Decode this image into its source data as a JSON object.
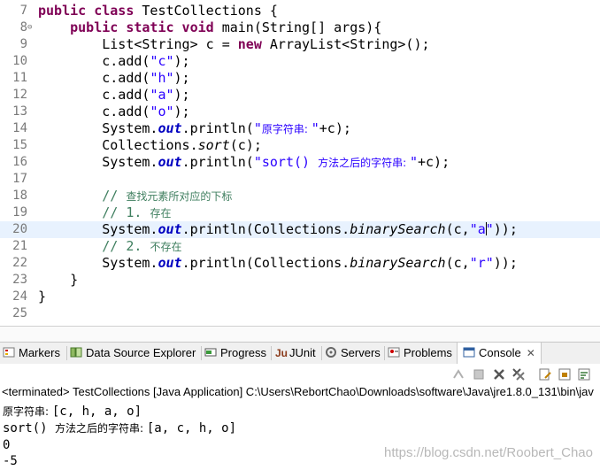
{
  "editor": {
    "lines": [
      {
        "num": "7",
        "code": [
          [
            "kw",
            "public class "
          ],
          [
            "",
            "TestCollections {"
          ]
        ]
      },
      {
        "num": "8",
        "fold": "⊖",
        "code": [
          [
            "",
            "    "
          ],
          [
            "kw",
            "public static void "
          ],
          [
            "",
            "main(String[] args){"
          ]
        ]
      },
      {
        "num": "9",
        "code": [
          [
            "",
            "        List<String> c = "
          ],
          [
            "kw",
            "new "
          ],
          [
            "",
            "ArrayList<String>();"
          ]
        ]
      },
      {
        "num": "10",
        "code": [
          [
            "",
            "        c.add("
          ],
          [
            "str",
            "\"c\""
          ],
          [
            "",
            ");"
          ]
        ]
      },
      {
        "num": "11",
        "code": [
          [
            "",
            "        c.add("
          ],
          [
            "str",
            "\"h\""
          ],
          [
            "",
            ");"
          ]
        ]
      },
      {
        "num": "12",
        "code": [
          [
            "",
            "        c.add("
          ],
          [
            "str",
            "\"a\""
          ],
          [
            "",
            ");"
          ]
        ]
      },
      {
        "num": "13",
        "code": [
          [
            "",
            "        c.add("
          ],
          [
            "str",
            "\"o\""
          ],
          [
            "",
            ");"
          ]
        ]
      },
      {
        "num": "14",
        "code": [
          [
            "",
            "        System."
          ],
          [
            "fld",
            "out"
          ],
          [
            "",
            ".println("
          ],
          [
            "str",
            "\""
          ],
          [
            "str cjk",
            "原字符串: "
          ],
          [
            "str",
            "\""
          ],
          [
            "",
            "+c);"
          ]
        ]
      },
      {
        "num": "15",
        "code": [
          [
            "",
            "        Collections."
          ],
          [
            "mth",
            "sort"
          ],
          [
            "",
            "(c);"
          ]
        ]
      },
      {
        "num": "16",
        "code": [
          [
            "",
            "        System."
          ],
          [
            "fld",
            "out"
          ],
          [
            "",
            ".println("
          ],
          [
            "str",
            "\"sort() "
          ],
          [
            "str cjk",
            "方法之后的字符串: "
          ],
          [
            "str",
            "\""
          ],
          [
            "",
            "+c);"
          ]
        ]
      },
      {
        "num": "17",
        "code": [
          [
            "",
            ""
          ]
        ]
      },
      {
        "num": "18",
        "code": [
          [
            "cmt",
            "        // "
          ],
          [
            "cmt cjk",
            "查找元素所对应的下标"
          ]
        ]
      },
      {
        "num": "19",
        "code": [
          [
            "cmt",
            "        // 1. "
          ],
          [
            "cmt cjk",
            "存在"
          ]
        ]
      },
      {
        "num": "20",
        "current": true,
        "code": [
          [
            "",
            "        System."
          ],
          [
            "fld",
            "out"
          ],
          [
            "",
            ".println(Collections."
          ],
          [
            "mth",
            "binarySearch"
          ],
          [
            "",
            "(c,"
          ],
          [
            "str",
            "\"a"
          ],
          [
            "caret",
            ""
          ],
          [
            "str",
            "\""
          ],
          [
            "",
            "));"
          ]
        ]
      },
      {
        "num": "21",
        "code": [
          [
            "cmt",
            "        // 2. "
          ],
          [
            "cmt cjk",
            "不存在"
          ]
        ]
      },
      {
        "num": "22",
        "code": [
          [
            "",
            "        System."
          ],
          [
            "fld",
            "out"
          ],
          [
            "",
            ".println(Collections."
          ],
          [
            "mth",
            "binarySearch"
          ],
          [
            "",
            "(c,"
          ],
          [
            "str",
            "\"r\""
          ],
          [
            "",
            "));"
          ]
        ]
      },
      {
        "num": "23",
        "code": [
          [
            "",
            "    }"
          ]
        ]
      },
      {
        "num": "24",
        "code": [
          [
            "",
            "}"
          ]
        ]
      },
      {
        "num": "25",
        "code": [
          [
            "",
            ""
          ]
        ]
      }
    ]
  },
  "tabs": {
    "markers": "Markers",
    "data_source": "Data Source Explorer",
    "progress": "Progress",
    "junit": "JUnit",
    "servers": "Servers",
    "problems": "Problems",
    "console": "Console",
    "console_close": "✕"
  },
  "console": {
    "status": "<terminated> TestCollections [Java Application] C:\\Users\\RebortChao\\Downloads\\software\\Java\\jre1.8.0_131\\bin\\jav",
    "out1_cjk": "原字符串: ",
    "out1_rest": "[c, h, a, o]",
    "out2_pre": "sort() ",
    "out2_cjk": "方法之后的字符串: ",
    "out2_rest": "[a, c, h, o]",
    "out3": "0",
    "out4": "-5"
  },
  "watermark": "https://blog.csdn.net/Roobert_Chao",
  "colors": {
    "keyword": "#7f0055",
    "string": "#2a00ff",
    "field": "#0000c0",
    "comment": "#3f7f5f",
    "current_line": "#e8f2fe"
  }
}
